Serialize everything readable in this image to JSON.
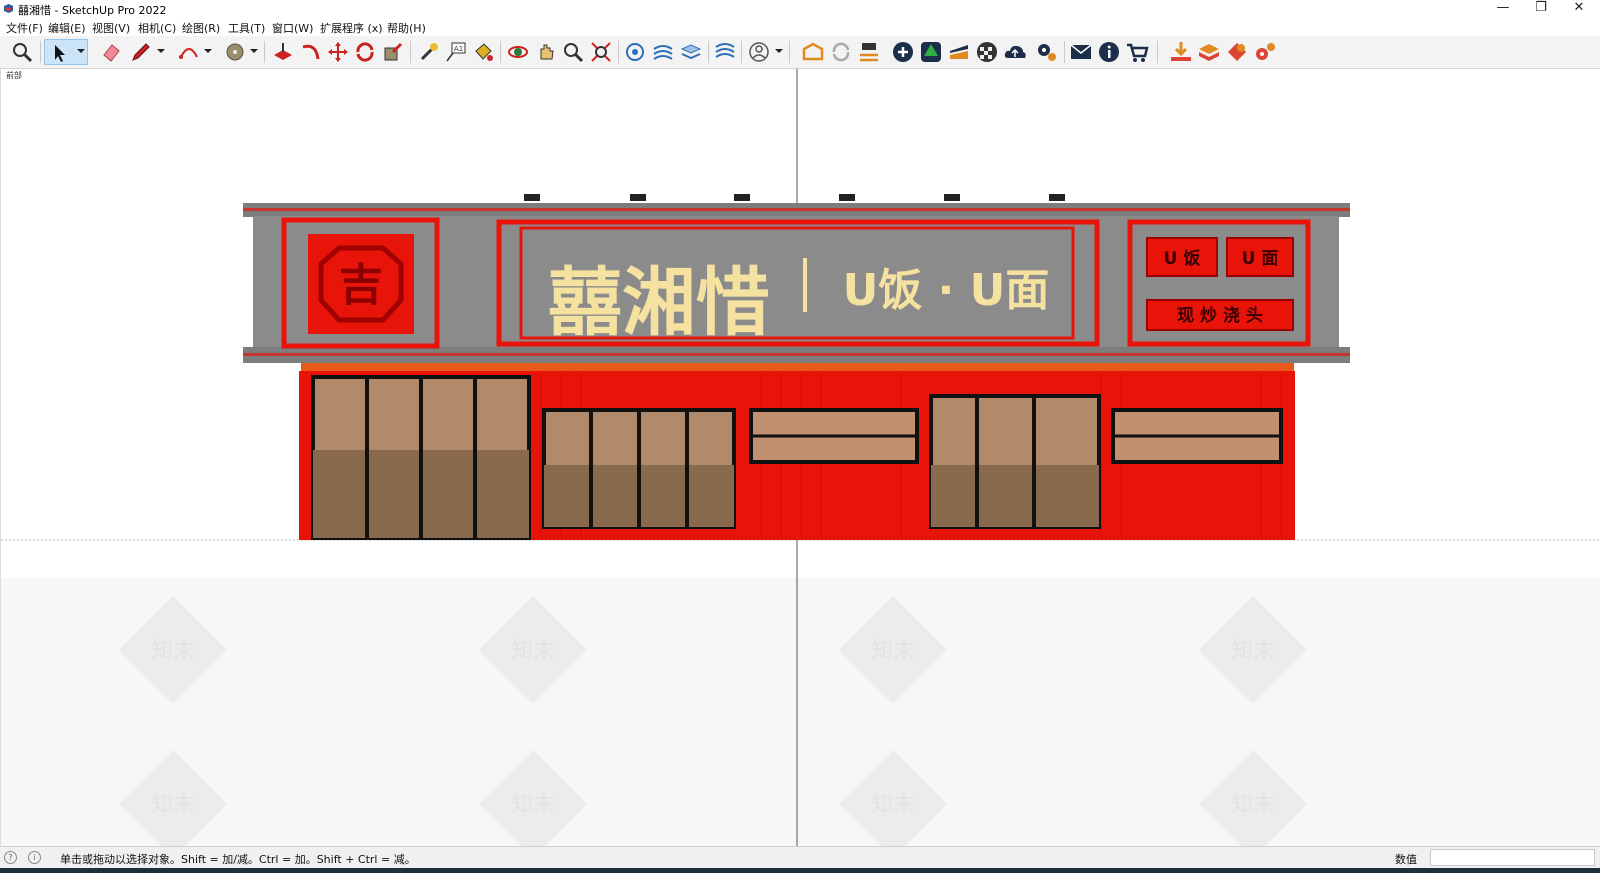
{
  "window": {
    "title": "囍湘惜 - SketchUp Pro 2022",
    "controls": [
      "—",
      "❐",
      "✕"
    ]
  },
  "menu": [
    "文件(F)",
    "编辑(E)",
    "视图(V)",
    "相机(C)",
    "绘图(R)",
    "工具(T)",
    "窗口(W)",
    "扩展程序 (x)",
    "帮助(H)"
  ],
  "toolbar_icons": [
    "zoom-icon",
    "select-icon",
    "eraser-icon",
    "pencil-icon",
    "arc-icon",
    "circle-icon",
    "paint-icon",
    "follow-me-icon",
    "move-icon",
    "rotate-icon",
    "push-pull-icon",
    "tape-measure-icon",
    "text-icon",
    "paint-bucket-icon",
    "orbit-icon",
    "pan-icon",
    "zoom-window-icon",
    "zoom-extents-icon",
    "components-icon",
    "sandbox-icon",
    "layers-icon",
    "styles-icon",
    "user-icon",
    "warehouse-icon",
    "sync-icon",
    "export-icon",
    "add-icon",
    "tree-icon",
    "chart-icon",
    "checker-icon",
    "cloud-icon",
    "gears-icon",
    "mail-icon",
    "info-icon",
    "cart-icon",
    "download-icon",
    "box-icon",
    "extension-icon",
    "settings-icon"
  ],
  "viewport": {
    "scene_label": "前部"
  },
  "storefront": {
    "brand_name": "囍湘惜",
    "slogan": "U饭 · U面",
    "side_signs": [
      "U 饭",
      "U 面",
      "现 炒 浇 头"
    ],
    "logo_glyph": "吉",
    "watermark": "知末",
    "colors": {
      "red": "#e8140a",
      "gray": "#8b8b8b",
      "cream": "#f5e2a0",
      "dark_red": "#b40a05"
    }
  },
  "status": {
    "message": "单击或拖动以选择对象。Shift = 加/减。Ctrl = 加。Shift + Ctrl = 减。",
    "value_label": "数值",
    "value": ""
  }
}
